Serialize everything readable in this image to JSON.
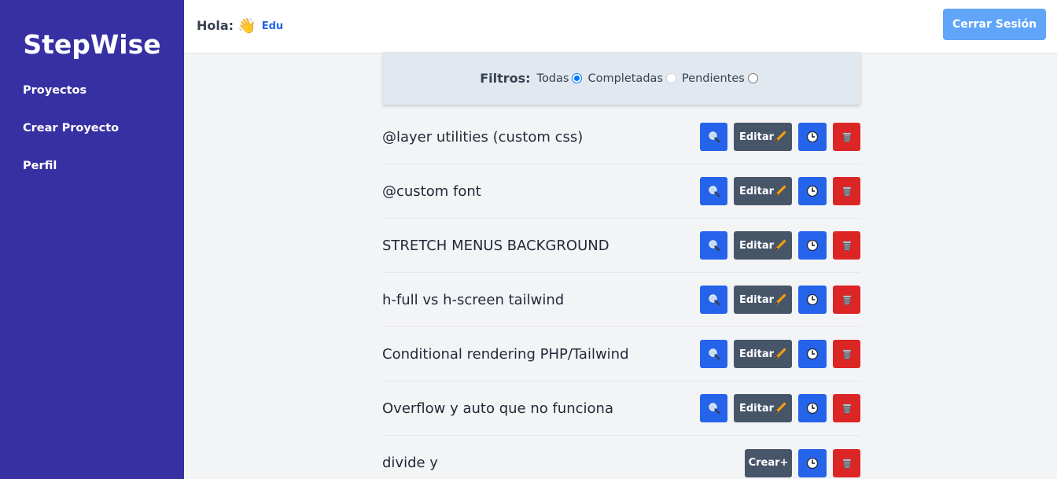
{
  "sidebar": {
    "brand": "StepWise",
    "items": [
      {
        "label": "Proyectos"
      },
      {
        "label": "Crear Proyecto"
      },
      {
        "label": "Perfil"
      }
    ]
  },
  "header": {
    "greeting": "Hola:",
    "wave": "👋",
    "user": "Edu",
    "logout_label": "Cerrar Sesión"
  },
  "filters": {
    "label": "Filtros:",
    "options": [
      {
        "label": "Todas",
        "checked": true
      },
      {
        "label": "Completadas",
        "checked": false
      },
      {
        "label": "Pendientes",
        "checked": false
      }
    ]
  },
  "tasks": [
    {
      "title": "@layer utilities (custom css)",
      "edit_label": "Editar"
    },
    {
      "title": "@custom font",
      "edit_label": "Editar"
    },
    {
      "title": "STRETCH MENUS BACKGROUND",
      "edit_label": "Editar"
    },
    {
      "title": "h-full vs h-screen tailwind",
      "edit_label": "Editar"
    },
    {
      "title": "Conditional rendering PHP/Tailwind",
      "edit_label": "Editar"
    },
    {
      "title": "Overflow y auto que no funciona",
      "edit_label": "Editar"
    },
    {
      "title": "divide y",
      "create_label": "Crear+"
    }
  ],
  "colors": {
    "sidebar": "#3730a3",
    "primary": "#2563eb",
    "secondary": "#475569",
    "danger": "#dc2626",
    "logout": "#60a5fa"
  },
  "icons": {
    "view": "magnifier-icon",
    "edit": "pencil-icon",
    "history": "clock-icon",
    "delete": "trash-icon"
  }
}
